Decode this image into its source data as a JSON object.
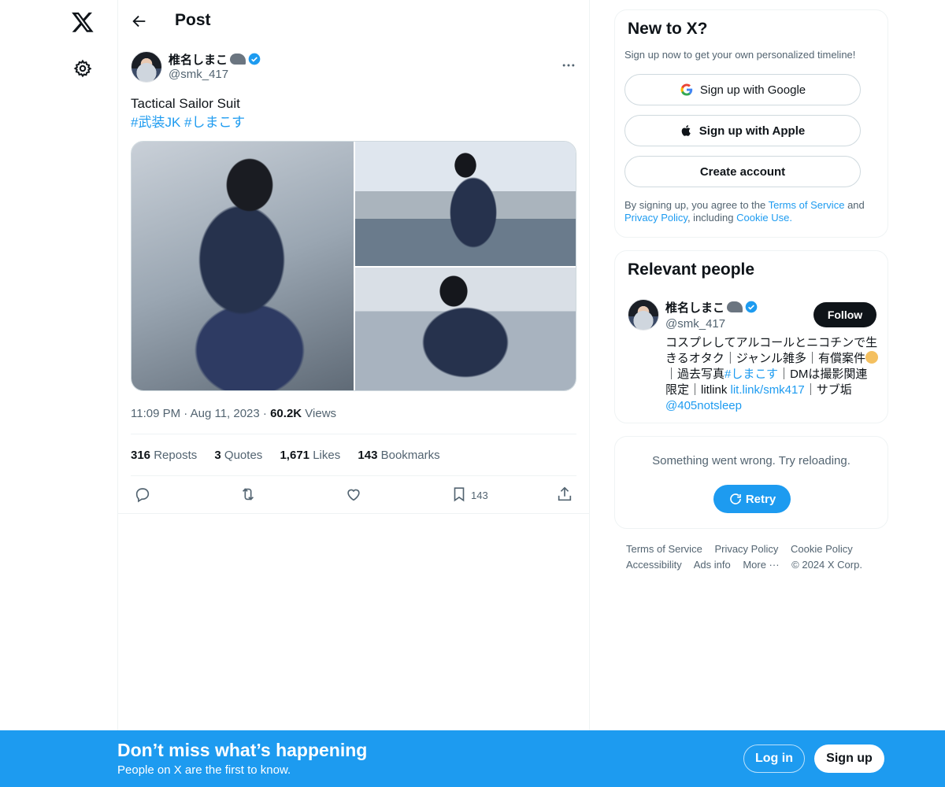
{
  "header": {
    "title": "Post"
  },
  "post": {
    "author_name": "椎名しまこ",
    "author_handle": "@smk_417",
    "text": "Tactical Sailor Suit",
    "hashtags": [
      "#武装JK",
      "#しまこす"
    ],
    "time": "11:09 PM",
    "date": "Aug 11, 2023",
    "views_count": "60.2K",
    "views_label": "Views",
    "reposts_count": "316",
    "reposts_label": "Reposts",
    "quotes_count": "3",
    "quotes_label": "Quotes",
    "likes_count": "1,671",
    "likes_label": "Likes",
    "bookmarks_count": "143",
    "bookmarks_label": "Bookmarks",
    "bookmark_action_count": "143"
  },
  "signup_card": {
    "title": "New to X?",
    "subtitle": "Sign up now to get your own personalized timeline!",
    "google_label": "Sign up with Google",
    "apple_label": "Sign up with Apple",
    "create_label": "Create account",
    "legal_prefix": "By signing up, you agree to the",
    "terms_link": "Terms of Service",
    "legal_and": "and",
    "privacy_link": "Privacy Policy",
    "legal_including": ", including",
    "cookie_link": "Cookie Use."
  },
  "relevant_people": {
    "title": "Relevant people",
    "name": "椎名しまこ",
    "handle": "@smk_417",
    "follow_label": "Follow",
    "bio_1": "コスプレしてアルコールとニコチンで生きるオタク｜ジャンル雑多｜有償案件",
    "bio_2": "｜過去写真",
    "bio_tag": "#しまこす",
    "bio_3": "｜DMは撮影関連限定｜litlink",
    "bio_link": "lit.link/smk417",
    "bio_4": "｜サブ垢",
    "bio_sub": "@405notsleep"
  },
  "error_card": {
    "message": "Something went wrong. Try reloading.",
    "retry_label": "Retry"
  },
  "footer": {
    "links": [
      "Terms of Service",
      "Privacy Policy",
      "Cookie Policy",
      "Accessibility",
      "Ads info",
      "More ···",
      "© 2024 X Corp."
    ]
  },
  "bottom_bar": {
    "headline": "Don’t miss what’s happening",
    "subline": "People on X are the first to know.",
    "login_label": "Log in",
    "signup_label": "Sign up"
  },
  "colors": {
    "accent": "#1d9bf0",
    "text": "#0f1419",
    "secondary": "#536471",
    "border": "#eff3f4"
  },
  "icons": [
    "x-logo-icon",
    "gear-icon",
    "back-arrow-icon",
    "verified-icon",
    "more-icon",
    "reply-icon",
    "repost-icon",
    "like-icon",
    "bookmark-icon",
    "share-icon",
    "google-icon",
    "apple-icon",
    "refresh-icon"
  ]
}
